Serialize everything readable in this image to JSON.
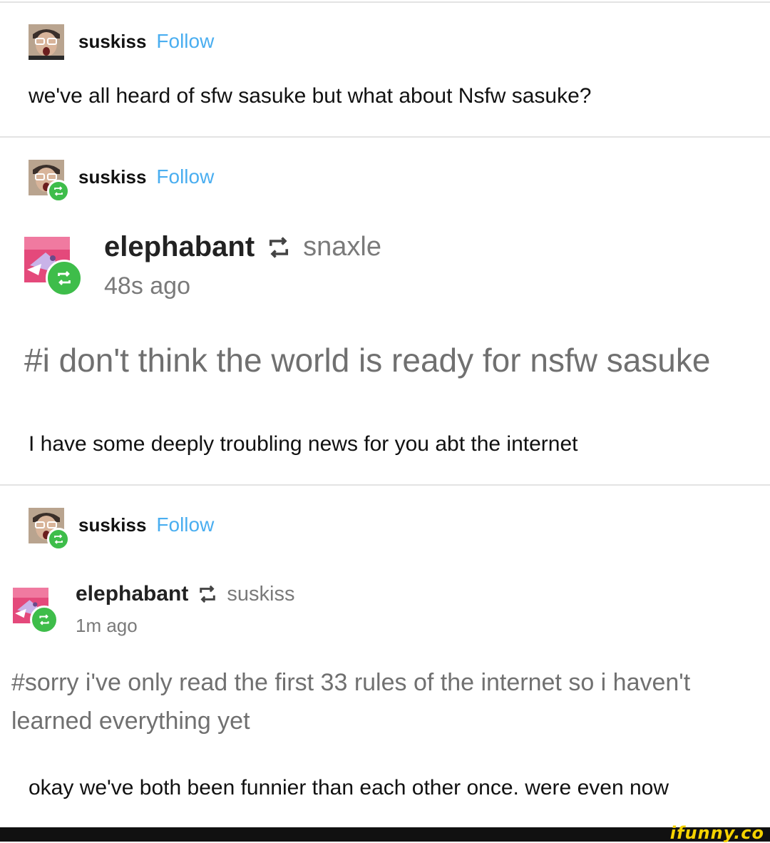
{
  "posts": [
    {
      "username": "suskiss",
      "follow_label": "Follow",
      "text": "we've all heard of sfw sasuke but what about Nsfw sasuke?"
    },
    {
      "username": "suskiss",
      "follow_label": "Follow",
      "reblog": {
        "username": "elephabant",
        "via": "snaxle",
        "time": "48s ago",
        "tags": "#i don't think the world is ready for nsfw sasuke"
      },
      "text": "I have some deeply troubling news for you abt the internet"
    },
    {
      "username": "suskiss",
      "follow_label": "Follow",
      "reblog": {
        "username": "elephabant",
        "via": "suskiss",
        "time": "1m ago",
        "tags_line1": "#sorry i've only read the first 33 rules of the internet so i haven't",
        "tags_line2": "learned everything yet"
      },
      "text": "okay we've both been funnier than each other once. were even now"
    }
  ],
  "watermark": "ifunny.co",
  "colors": {
    "follow": "#4aaef0",
    "reblog_badge": "#3ebd4a",
    "divider": "#e3e3e3"
  }
}
